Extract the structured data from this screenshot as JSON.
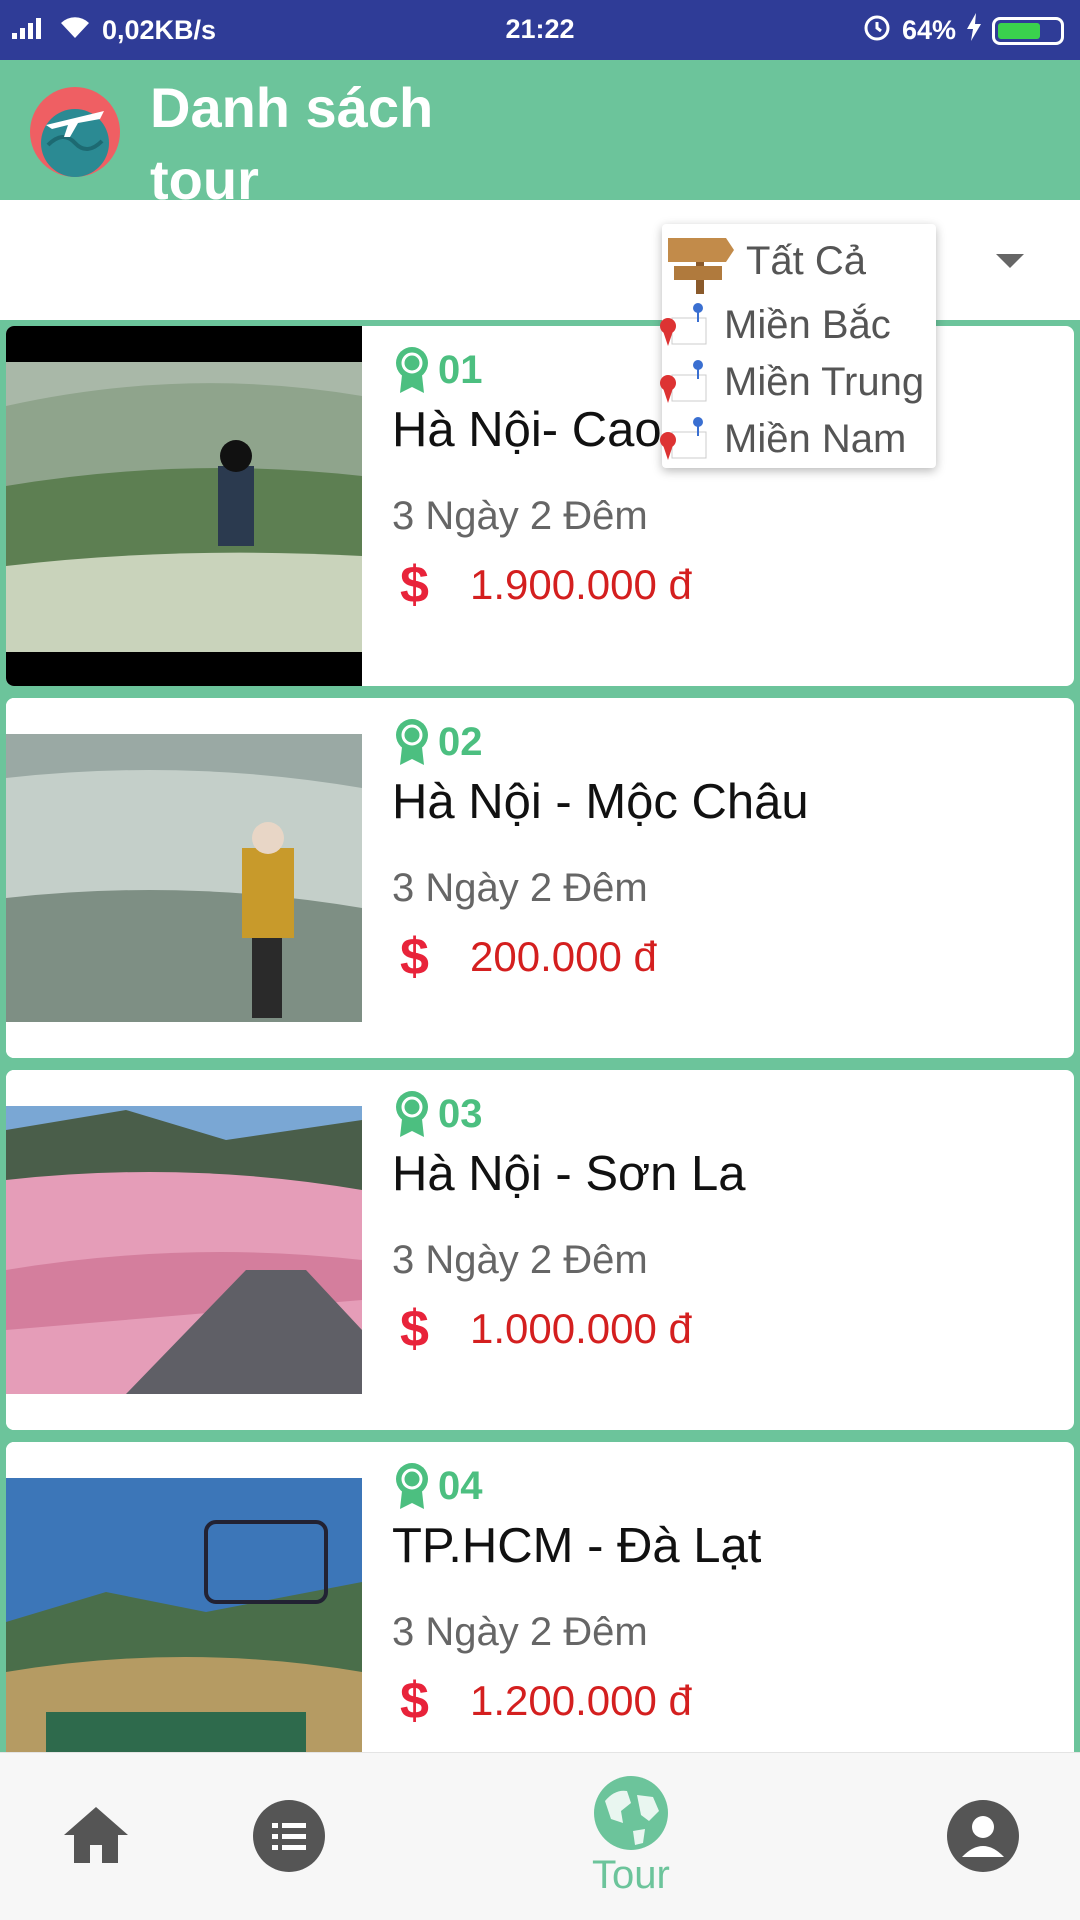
{
  "status_bar": {
    "network_speed": "0,02KB/s",
    "time": "21:22",
    "battery_percent": "64%",
    "battery_level": 0.64
  },
  "app_bar": {
    "title": "Danh sách tour"
  },
  "filter": {
    "options": [
      {
        "label": "Tất Cả"
      },
      {
        "label": "Miền Bắc"
      },
      {
        "label": "Miền Trung"
      },
      {
        "label": "Miền Nam"
      }
    ]
  },
  "tours": [
    {
      "rank": "01",
      "name": "Hà Nội- Cao",
      "duration": "3 Ngày 2 Đêm",
      "currency_symbol": "$",
      "price": "1.900.000 đ"
    },
    {
      "rank": "02",
      "name": "Hà Nội - Mộc Châu",
      "duration": "3 Ngày 2 Đêm",
      "currency_symbol": "$",
      "price": "200.000 đ"
    },
    {
      "rank": "03",
      "name": "Hà Nội - Sơn La",
      "duration": "3 Ngày 2 Đêm",
      "currency_symbol": "$",
      "price": "1.000.000 đ"
    },
    {
      "rank": "04",
      "name": "TP.HCM - Đà Lạt",
      "duration": "3 Ngày 2 Đêm",
      "currency_symbol": "$",
      "price": "1.200.000 đ"
    }
  ],
  "bottom_nav": {
    "items": [
      {
        "icon": "home-icon"
      },
      {
        "icon": "list-icon"
      },
      {
        "icon": "globe-icon",
        "label": "Tour"
      },
      {
        "icon": "profile-icon"
      }
    ]
  },
  "colors": {
    "primary": "#6cc49b",
    "status_bar": "#2f3c97",
    "price": "#d41f1f",
    "rank": "#4cbf80"
  }
}
